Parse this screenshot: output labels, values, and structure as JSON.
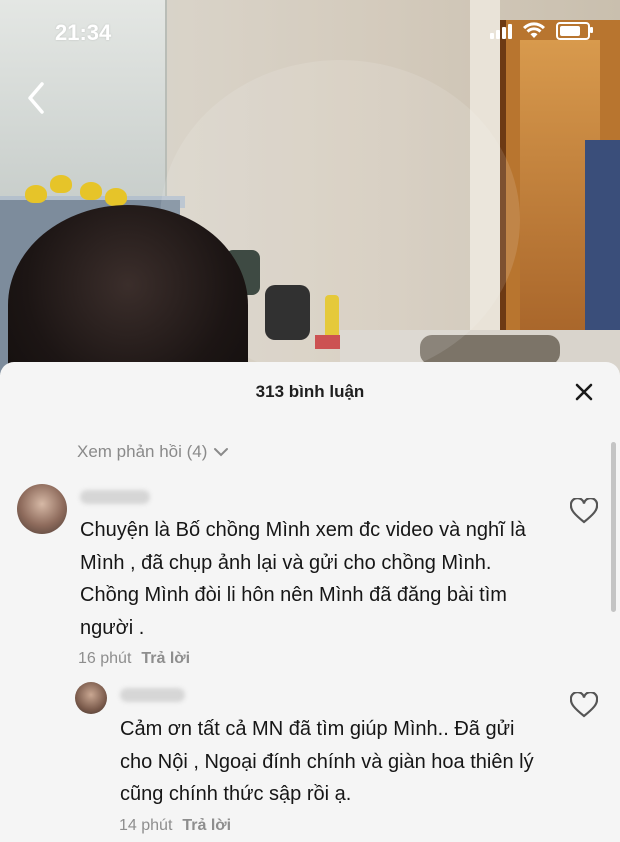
{
  "status_bar": {
    "time": "21:34"
  },
  "sheet": {
    "title": "313 bình luận",
    "view_replies": "Xem phản hồi (4)"
  },
  "comments": [
    {
      "text": "Chuyện là Bố chồng Mình xem đc video và nghĩ là Mình , đã chụp ảnh lại và gửi cho chồng Mình. Chồng Mình đòi li hôn nên Mình đã đăng bài tìm người .",
      "time": "16 phút",
      "reply_label": "Trả lời"
    },
    {
      "text": "Cảm ơn tất cả MN đã tìm giúp Mình.. Đã gửi cho Nội , Ngoại đính chính và giàn hoa thiên lý cũng chính thức sập rồi ạ.",
      "time": "14 phút",
      "reply_label": "Trả lời"
    }
  ],
  "icons": {
    "back": "chevron-left-icon",
    "close": "close-icon",
    "like": "heart-outline-icon",
    "wifi": "wifi-icon",
    "battery": "battery-icon",
    "signal": "signal-icon",
    "expand": "chevron-down-icon"
  },
  "colors": {
    "sheet_background": "#f5f5f5",
    "muted_text": "#8e8e8e",
    "body_text": "#161616"
  }
}
